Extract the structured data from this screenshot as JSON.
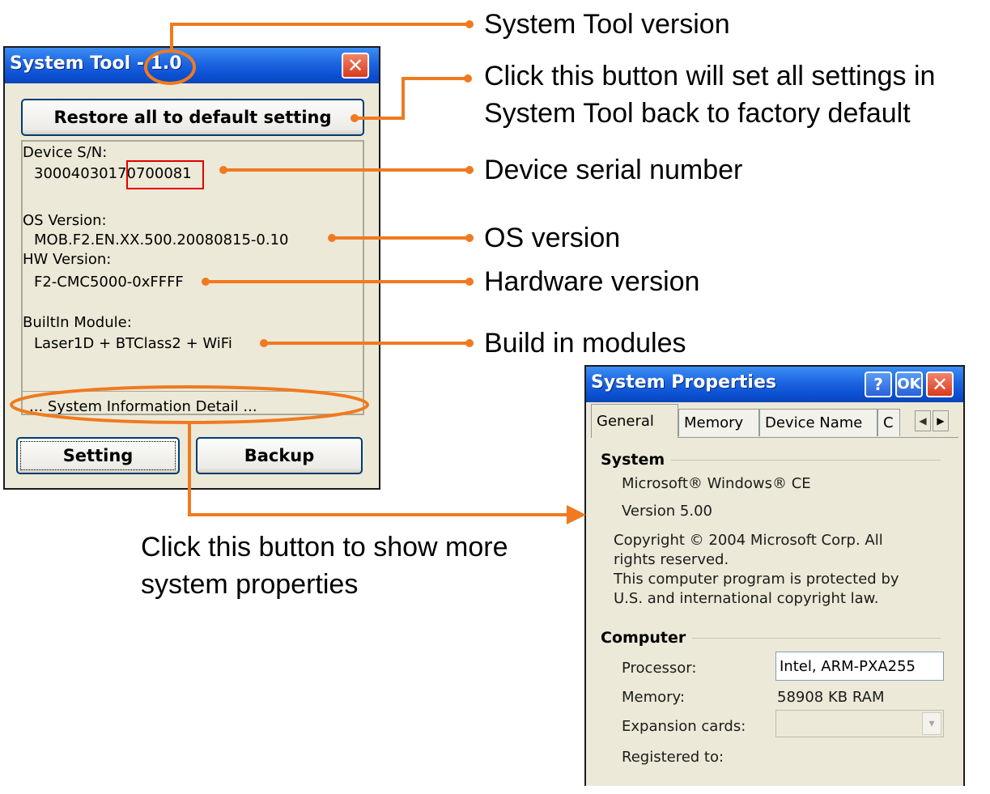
{
  "system_tool": {
    "title": "System Tool - 1.0",
    "restore_button": "Restore all to default setting",
    "device_sn_label": "Device S/N:",
    "device_sn_value": "30004030170700081",
    "os_version_label": "OS Version:",
    "os_version_value": "MOB.F2.EN.XX.500.20080815-0.10",
    "hw_version_label": "HW Version:",
    "hw_version_value": "F2-CMC5000-0xFFFF",
    "builtin_label": "BuiltIn Module:",
    "builtin_value": "Laser1D + BTClass2 + WiFi",
    "detail_button": "... System Information Detail ...",
    "setting_button": "Setting",
    "backup_button": "Backup",
    "close_glyph": "✕"
  },
  "system_properties": {
    "title": "System Properties",
    "help_glyph": "?",
    "ok_label": "OK",
    "close_glyph": "✕",
    "tabs": [
      "General",
      "Memory",
      "Device Name",
      "C"
    ],
    "system_group": "System",
    "os_name": "Microsoft® Windows® CE",
    "os_version": "Version 5.00",
    "copyright_lines": [
      "Copyright © 2004 Microsoft Corp. All",
      "rights reserved.",
      "This computer program is protected by",
      "U.S. and international copyright law."
    ],
    "computer_group": "Computer",
    "processor_label": "Processor:",
    "processor_value": "Intel, ARM-PXA255",
    "memory_label": "Memory:",
    "memory_value": "58908 KB  RAM",
    "expansion_label": "Expansion cards:",
    "expansion_value": "",
    "registered_label": "Registered to:"
  },
  "callouts": {
    "tool_version": "System Tool version",
    "restore_line1": "Click this button will set all settings in",
    "restore_line2": "System Tool back to factory default",
    "serial": "Device serial number",
    "os": "OS version",
    "hardware": "Hardware version",
    "modules": "Build in modules",
    "more_line1": "Click this button to show more",
    "more_line2": "system properties"
  },
  "colors": {
    "callout_orange": "#f07a1f",
    "highlight_red": "#e00000",
    "titlebar_blue": "#0a4fd1"
  }
}
